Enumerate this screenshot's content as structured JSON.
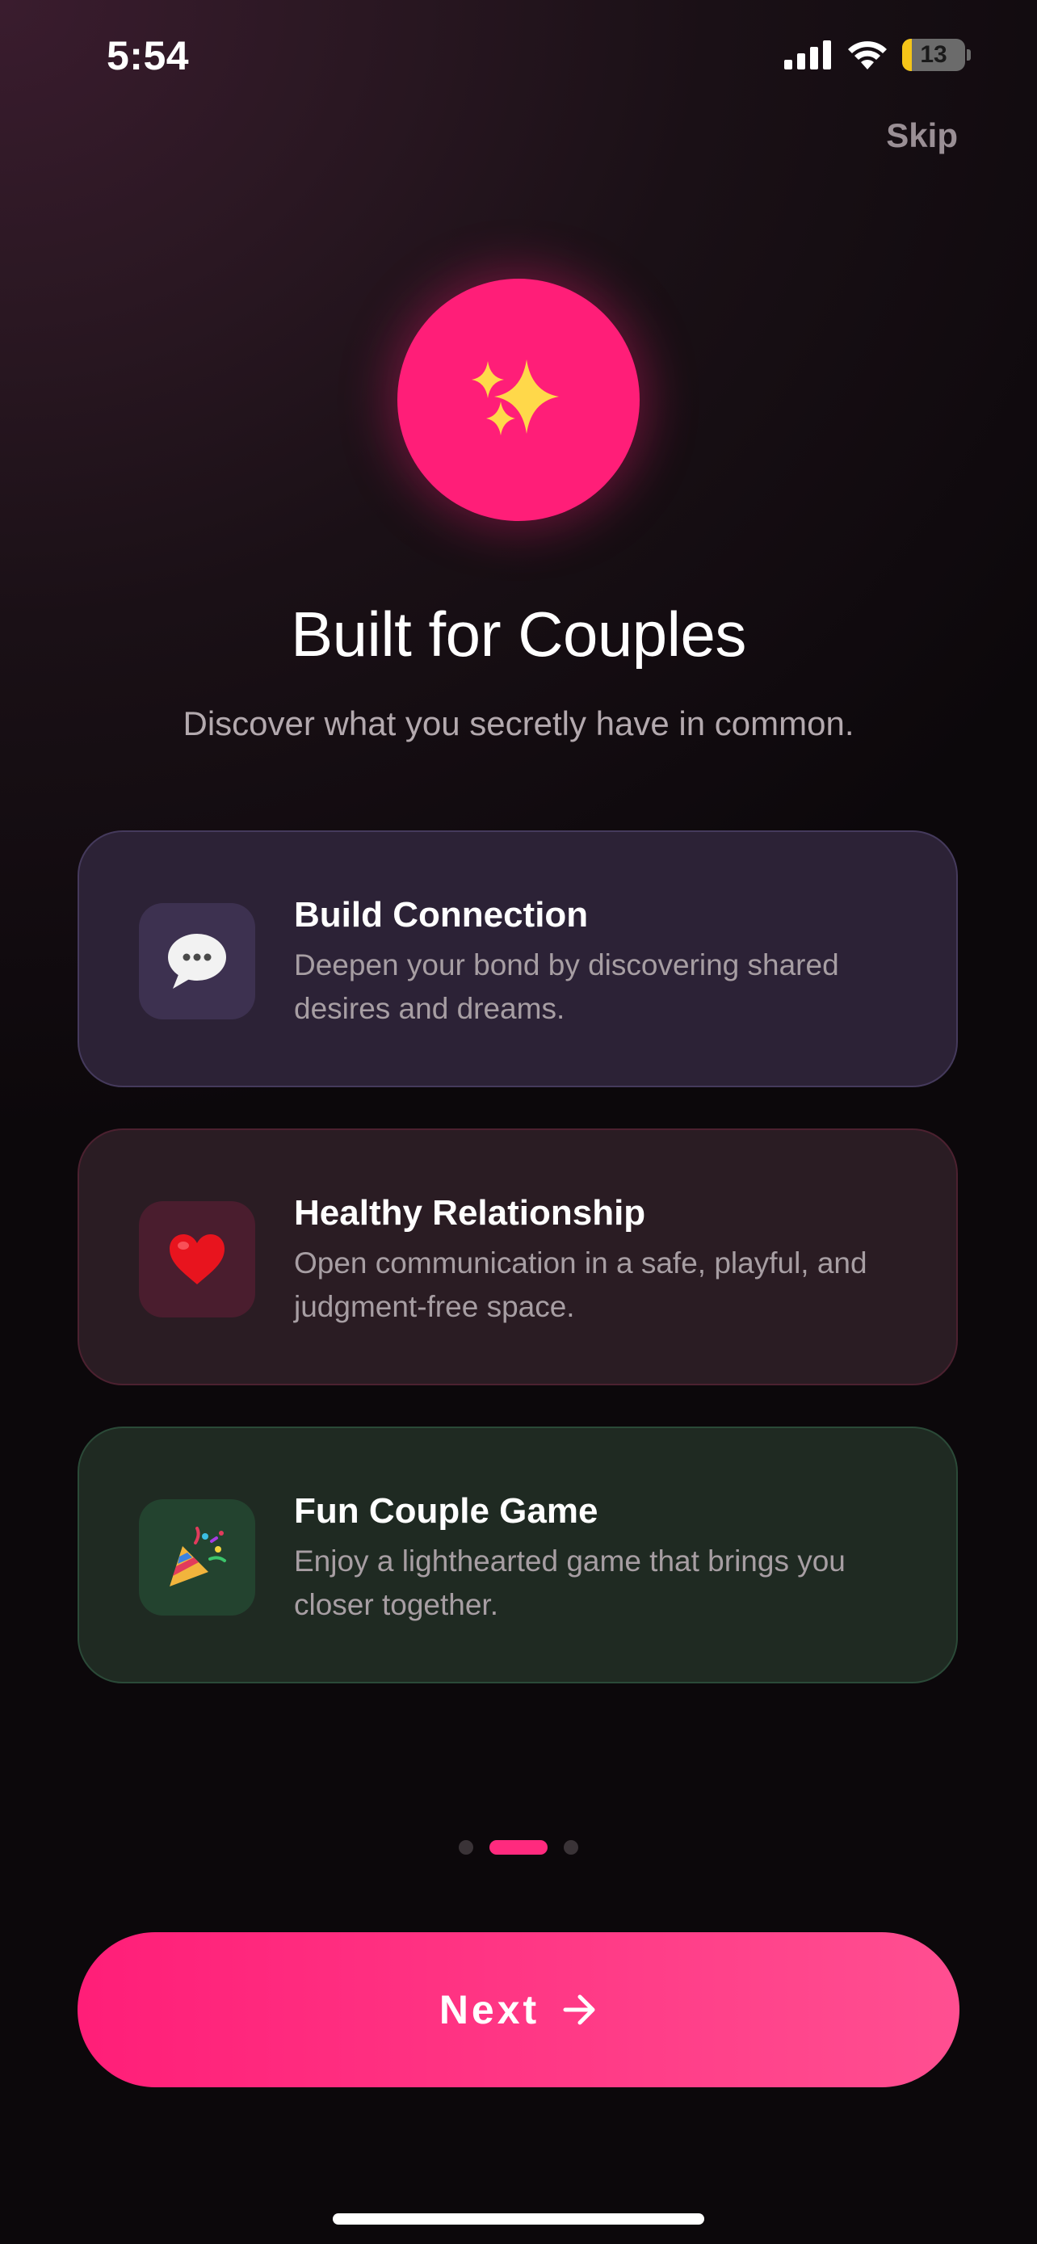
{
  "status_bar": {
    "time": "5:54",
    "battery_level": "13",
    "battery_fraction": 0.13
  },
  "header": {
    "skip_label": "Skip"
  },
  "hero": {
    "icon": "sparkles-icon",
    "title": "Built for Couples",
    "subtitle": "Discover what you secretly have in common."
  },
  "features": [
    {
      "icon": "speech-bubble-icon",
      "title": "Build Connection",
      "description": "Deepen your bond by discovering shared desires and dreams."
    },
    {
      "icon": "heart-icon",
      "title": "Healthy Relationship",
      "description": "Open communication in a safe, playful, and judgment-free space."
    },
    {
      "icon": "party-popper-icon",
      "title": "Fun Couple Game",
      "description": "Enjoy a lighthearted game that brings you closer together."
    }
  ],
  "pagination": {
    "total": 3,
    "current": 2
  },
  "footer": {
    "next_label": "Next"
  },
  "colors": {
    "accent": "#ff1e78",
    "card_purple": "#2c2236",
    "card_red": "#2a1c23",
    "card_green": "#1f2a22"
  }
}
